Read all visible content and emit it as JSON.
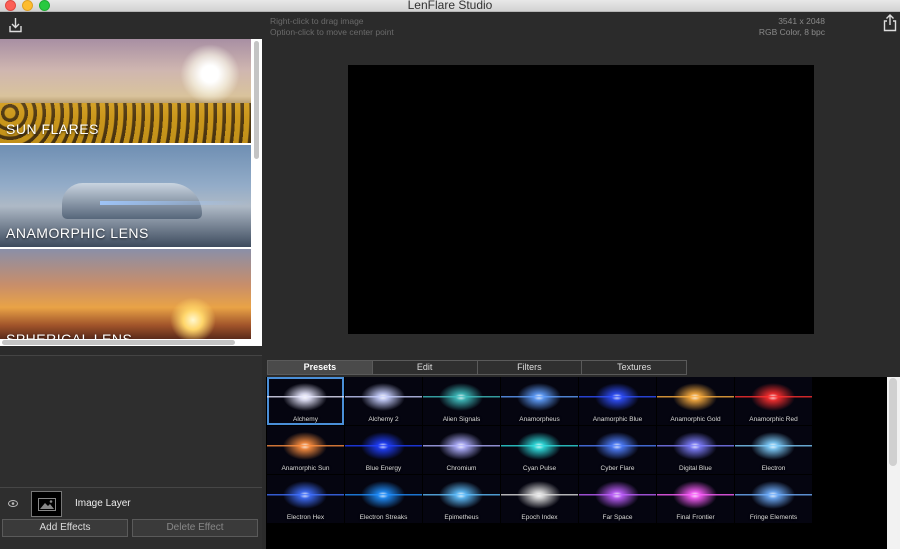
{
  "window": {
    "title": "LenFlare Studio"
  },
  "toolbar": {
    "import_icon": "import-icon",
    "share_icon": "share-icon"
  },
  "categories": [
    {
      "label": "SUN FLARES"
    },
    {
      "label": "ANAMORPHIC LENS"
    },
    {
      "label": "SPHERICAL LENS"
    }
  ],
  "canvas": {
    "hint_line1": "Right-click to drag image",
    "hint_line2": "Option-click to move center point",
    "dimensions": "3541 x 2048",
    "color_mode": "RGB Color, 8 bpc"
  },
  "layers": [
    {
      "name": "Image Layer",
      "visible": true
    }
  ],
  "buttons": {
    "add_effects": "Add Effects",
    "delete_effect": "Delete Effect"
  },
  "tabs": [
    {
      "label": "Presets",
      "active": true
    },
    {
      "label": "Edit",
      "active": false
    },
    {
      "label": "Filters",
      "active": false
    },
    {
      "label": "Textures",
      "active": false
    }
  ],
  "presets": [
    {
      "name": "Alchemy",
      "color": "#e8e8ff",
      "selected": true
    },
    {
      "name": "Alchemy 2",
      "color": "#c8d0ff"
    },
    {
      "name": "Alien Signals",
      "color": "#40c0c0"
    },
    {
      "name": "Anamorpheus",
      "color": "#60a0ff"
    },
    {
      "name": "Anamorphic Blue",
      "color": "#3050ff"
    },
    {
      "name": "Anamorphic Gold",
      "color": "#ffb040"
    },
    {
      "name": "Anamorphic Red",
      "color": "#ff3030"
    },
    {
      "name": "Anamorphic Sun",
      "color": "#ff9040"
    },
    {
      "name": "Blue Energy",
      "color": "#2040ff"
    },
    {
      "name": "Chromium",
      "color": "#b0b0ff"
    },
    {
      "name": "Cyan Pulse",
      "color": "#30e0e0"
    },
    {
      "name": "Cyber Flare",
      "color": "#5080ff"
    },
    {
      "name": "Digital Blue",
      "color": "#8080ff"
    },
    {
      "name": "Electron",
      "color": "#80d0ff"
    },
    {
      "name": "Electron Hex",
      "color": "#4070ff"
    },
    {
      "name": "Electron Streaks",
      "color": "#2090ff"
    },
    {
      "name": "Epimetheus",
      "color": "#60c0ff"
    },
    {
      "name": "Epoch Index",
      "color": "#e0e0e0"
    },
    {
      "name": "Far Space",
      "color": "#c060ff"
    },
    {
      "name": "Final Frontier",
      "color": "#ff60ff"
    },
    {
      "name": "Fringe Elements",
      "color": "#70b0ff"
    }
  ]
}
